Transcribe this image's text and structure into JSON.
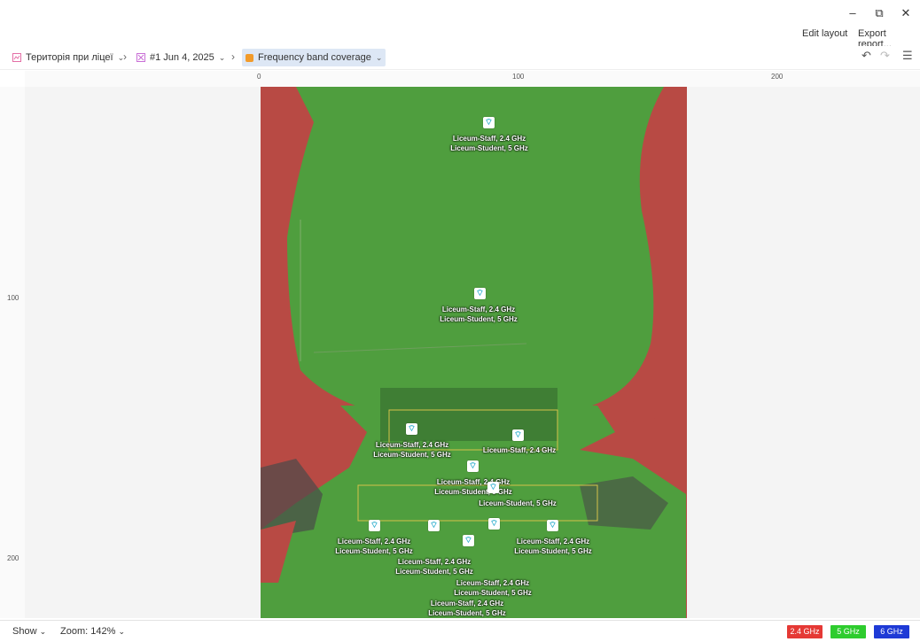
{
  "window": {
    "minimize_label": "–",
    "restore_label": "⧉",
    "close_label": "✕"
  },
  "top_actions": {
    "edit_layout": "Edit layout",
    "export_report": "Export report..."
  },
  "breadcrumb": {
    "site": {
      "label": "Територія при ліцеї",
      "color": "#e46fa6"
    },
    "survey": {
      "label": "#1 Jun 4, 2025",
      "color": "#c96fd6"
    },
    "view": {
      "label": "Frequency band coverage",
      "color": "#f29b2b"
    }
  },
  "rulers": {
    "horizontal": [
      {
        "label": "0"
      },
      {
        "label": "100"
      },
      {
        "label": "200"
      }
    ],
    "vertical": [
      {
        "label": "100"
      },
      {
        "label": "200"
      }
    ]
  },
  "access_points": [
    {
      "labels": [
        "Liceum-Staff, 2.4 GHz",
        "Liceum-Student, 5 GHz"
      ]
    },
    {
      "labels": [
        "Liceum-Staff, 2.4 GHz",
        "Liceum-Student, 5 GHz"
      ]
    },
    {
      "labels": [
        "Liceum-Staff, 2.4 GHz",
        "Liceum-Student, 5 GHz"
      ]
    },
    {
      "labels": [
        "Liceum-Staff, 2.4 GHz"
      ]
    },
    {
      "labels": [
        "Liceum-Staff, 2.4 GHz",
        "Liceum-Student, 5 GHz"
      ]
    },
    {
      "labels": [
        "Liceum-Student, 5 GHz"
      ]
    },
    {
      "labels": [
        "Liceum-Staff, 2.4 GHz",
        "Liceum-Student, 5 GHz"
      ]
    },
    {
      "labels": [
        "Liceum-Staff, 2.4 GHz",
        "Liceum-Student, 5 GHz"
      ]
    },
    {
      "labels": [
        "Liceum-Staff, 2.4 GHz",
        "Liceum-Student, 5 GHz"
      ]
    },
    {
      "labels": [
        "Liceum-Staff, 2.4 GHz",
        "Liceum-Student, 5 GHz"
      ]
    },
    {
      "labels": [
        "Liceum-Staff, 2.4 GHz",
        "Liceum-Student, 5 GHz"
      ]
    }
  ],
  "status": {
    "show_label": "Show",
    "zoom_label": "Zoom: 142%"
  },
  "legend": [
    {
      "label": "2.4 GHz",
      "color": "#e53935"
    },
    {
      "label": "5 GHz",
      "color": "#2ecc2e"
    },
    {
      "label": "6 GHz",
      "color": "#1e3ad6"
    }
  ]
}
